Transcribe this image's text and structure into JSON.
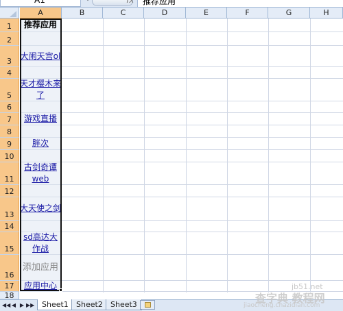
{
  "formula_bar": {
    "name_box": "A1",
    "formula": "推荐应用"
  },
  "columns": [
    "A",
    "B",
    "C",
    "D",
    "E",
    "F",
    "G",
    "H"
  ],
  "rows": [
    "1",
    "2",
    "3",
    "4",
    "5",
    "6",
    "7",
    "8",
    "9",
    "10",
    "11",
    "12",
    "13",
    "14",
    "15",
    "16",
    "17",
    "18"
  ],
  "column_a": {
    "header": "推荐应用",
    "links": [
      "大闹天宫ol",
      "天才樱木来了",
      "游戏直播",
      "胖次",
      "古剑奇谭web",
      "大天使之剑",
      "sd高达大作战"
    ],
    "add_app": "添加应用",
    "app_center": "应用中心"
  },
  "sheet_tabs": [
    "Sheet1",
    "Sheet2",
    "Sheet3"
  ],
  "active_sheet": "Sheet1",
  "watermark": {
    "site": "jb51.net",
    "name": "查字典 教程网",
    "url": "jiaocheng.chazidian.com"
  },
  "colors": {
    "header_bg": "#e4ecf7",
    "selected_header_bg": "#f8c78a",
    "link": "#1a1aa6"
  }
}
